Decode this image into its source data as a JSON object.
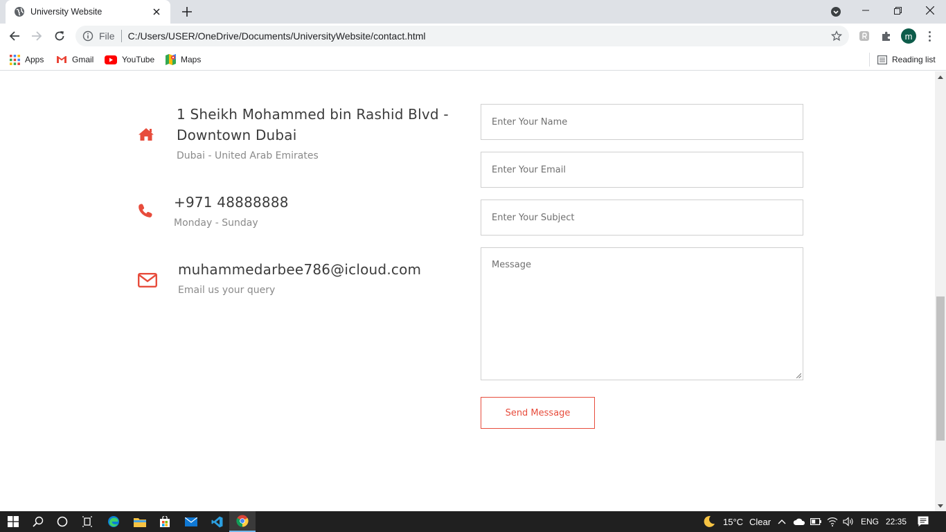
{
  "browser": {
    "tab": {
      "title": "University Website"
    },
    "address": {
      "scheme": "File",
      "url": "C:/Users/USER/OneDrive/Documents/UniversityWebsite/contact.html"
    },
    "profile_initial": "m",
    "bookmarks": [
      {
        "label": "Apps",
        "icon": "apps-grid-icon"
      },
      {
        "label": "Gmail",
        "icon": "gmail-icon"
      },
      {
        "label": "YouTube",
        "icon": "youtube-icon"
      },
      {
        "label": "Maps",
        "icon": "maps-icon"
      }
    ],
    "reading_list": "Reading list"
  },
  "contact": {
    "address": {
      "line": "1 Sheikh Mohammed bin Rashid Blvd - Downtown Dubai",
      "sub": "Dubai - United Arab Emirates",
      "icon": "home-icon"
    },
    "phone": {
      "line": "+971 48888888",
      "sub": "Monday - Sunday",
      "icon": "phone-icon"
    },
    "email": {
      "line": "muhammedarbee786@icloud.com",
      "sub": "Email us your query",
      "icon": "envelope-icon"
    },
    "accent_color": "#e74c3c"
  },
  "form": {
    "name_placeholder": "Enter Your Name",
    "email_placeholder": "Enter Your Email",
    "subject_placeholder": "Enter Your Subject",
    "message_placeholder": "Message",
    "submit_label": "Send Message"
  },
  "taskbar": {
    "weather": {
      "temp": "15°C",
      "condition": "Clear"
    },
    "language": "ENG",
    "time": "22:35"
  }
}
